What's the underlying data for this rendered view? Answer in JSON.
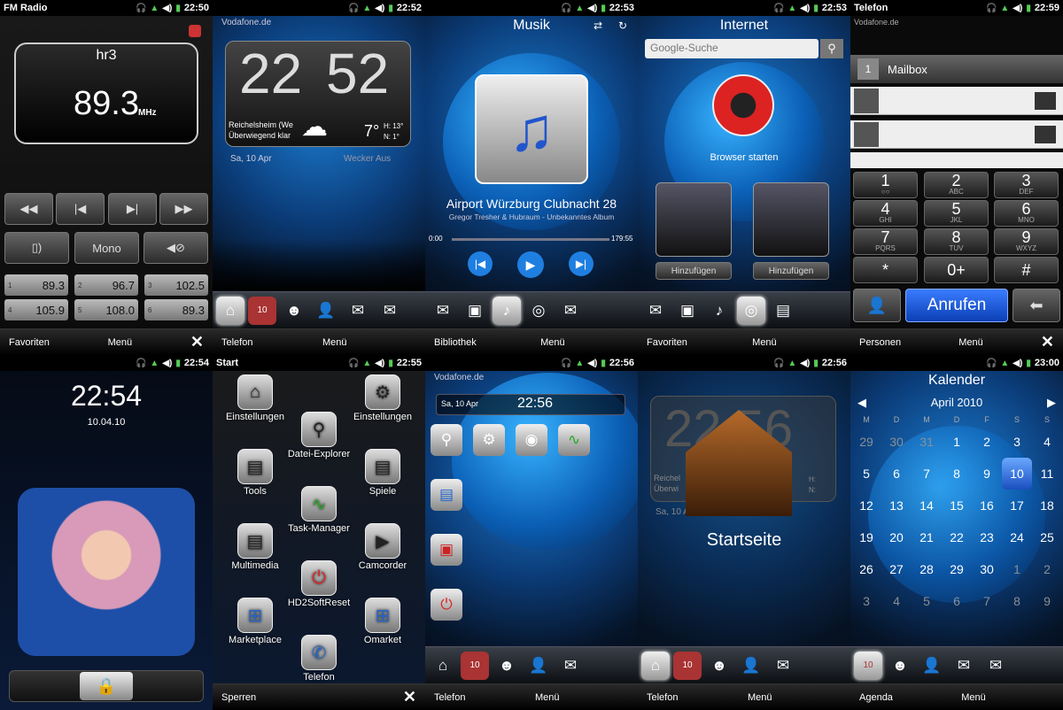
{
  "status_icons": {
    "headphones": "🎧",
    "signal": "▲",
    "volume": "◀)",
    "battery": "▮"
  },
  "p1": {
    "title": "FM Radio",
    "time": "22:50",
    "station": "hr3",
    "freq": "89.3",
    "unit": "MHz",
    "mono": "Mono",
    "presets": [
      {
        "n": "1",
        "v": "89.3"
      },
      {
        "n": "2",
        "v": "96.7"
      },
      {
        "n": "3",
        "v": "102.5"
      },
      {
        "n": "4",
        "v": "105.9"
      },
      {
        "n": "5",
        "v": "108.0"
      },
      {
        "n": "6",
        "v": "89.3"
      }
    ],
    "bottom_left": "Favoriten",
    "bottom_mid": "Menü",
    "close": "✕"
  },
  "p2": {
    "time": "22:52",
    "carrier": "Vodafone.de",
    "clock_h": "22",
    "clock_m": "52",
    "city": "Reichelsheim (We",
    "weather": "Überwiegend klar",
    "temp": "7°",
    "hi": "H: 13°",
    "lo": "N: 1°",
    "date": "Sa, 10 Apr",
    "alarm": "Wecker Aus",
    "bottom_left": "Telefon",
    "bottom_mid": "Menü",
    "cal_num": "10"
  },
  "p3": {
    "time": "22:53",
    "title": "Musik",
    "track": "Airport Würzburg Clubnacht 28",
    "artist": "Gregor Tresher & Hubraum - Unbekanntes Album",
    "pos": "0:00",
    "dur": "179:55",
    "bottom_left": "Bibliothek",
    "bottom_mid": "Menü"
  },
  "p4": {
    "time": "22:53",
    "title": "Internet",
    "search": "Google-Suche",
    "start": "Browser starten",
    "add1": "Hinzufügen",
    "add2": "Hinzufügen",
    "bottom_left": "Favoriten",
    "bottom_mid": "Menü"
  },
  "p5": {
    "title": "Telefon",
    "time": "22:59",
    "carrier": "Vodafone.de",
    "mailbox": "Mailbox",
    "keys": [
      {
        "k": "1",
        "s": "○○"
      },
      {
        "k": "2",
        "s": "ABC"
      },
      {
        "k": "3",
        "s": "DEF"
      },
      {
        "k": "4",
        "s": "GHI"
      },
      {
        "k": "5",
        "s": "JKL"
      },
      {
        "k": "6",
        "s": "MNO"
      },
      {
        "k": "7",
        "s": "PQRS"
      },
      {
        "k": "8",
        "s": "TUV"
      },
      {
        "k": "9",
        "s": "WXYZ"
      },
      {
        "k": "*",
        "s": ""
      },
      {
        "k": "0+",
        "s": ""
      },
      {
        "k": "#",
        "s": ""
      }
    ],
    "call": "Anrufen",
    "bottom_left": "Personen",
    "bottom_mid": "Menü",
    "close": "✕"
  },
  "p6": {
    "time": "22:54",
    "clock": "22:54",
    "date": "10.04.10"
  },
  "p7": {
    "title": "Start",
    "time": "22:55",
    "apps": [
      "Einstellungen",
      "Einstellungen",
      "Datei-Explorer",
      "Tools",
      "Spiele",
      "Task-Manager",
      "Multimedia",
      "Camcorder",
      "HD2SoftReset",
      "Marketplace",
      "Omarket",
      "Telefon"
    ],
    "bottom_left": "Sperren",
    "close": "✕"
  },
  "p8": {
    "time": "22:56",
    "carrier": "Vodafone.de",
    "date": "Sa, 10 Apr",
    "clock": "22:56",
    "bottom_left": "Telefon",
    "bottom_mid": "Menü"
  },
  "p9": {
    "time": "22:56",
    "label": "Startseite",
    "clock": "22 56",
    "city": "Reichel",
    "weather": "Überwi",
    "date": "Sa, 10 A",
    "hi": "H:",
    "lo": "N:",
    "bottom_left": "Telefon",
    "bottom_mid": "Menü"
  },
  "p10": {
    "time": "23:00",
    "title": "Kalender",
    "month": "April 2010",
    "days": [
      "M",
      "D",
      "M",
      "D",
      "F",
      "S",
      "S"
    ],
    "rows": [
      [
        "29",
        "30",
        "31",
        "1",
        "2",
        "3",
        "4"
      ],
      [
        "5",
        "6",
        "7",
        "8",
        "9",
        "10",
        "11"
      ],
      [
        "12",
        "13",
        "14",
        "15",
        "16",
        "17",
        "18"
      ],
      [
        "19",
        "20",
        "21",
        "22",
        "23",
        "24",
        "25"
      ],
      [
        "26",
        "27",
        "28",
        "29",
        "30",
        "1",
        "2"
      ],
      [
        "3",
        "4",
        "5",
        "6",
        "7",
        "8",
        "9"
      ]
    ],
    "bottom_left": "Agenda",
    "bottom_mid": "Menü",
    "cal_num": "10"
  }
}
